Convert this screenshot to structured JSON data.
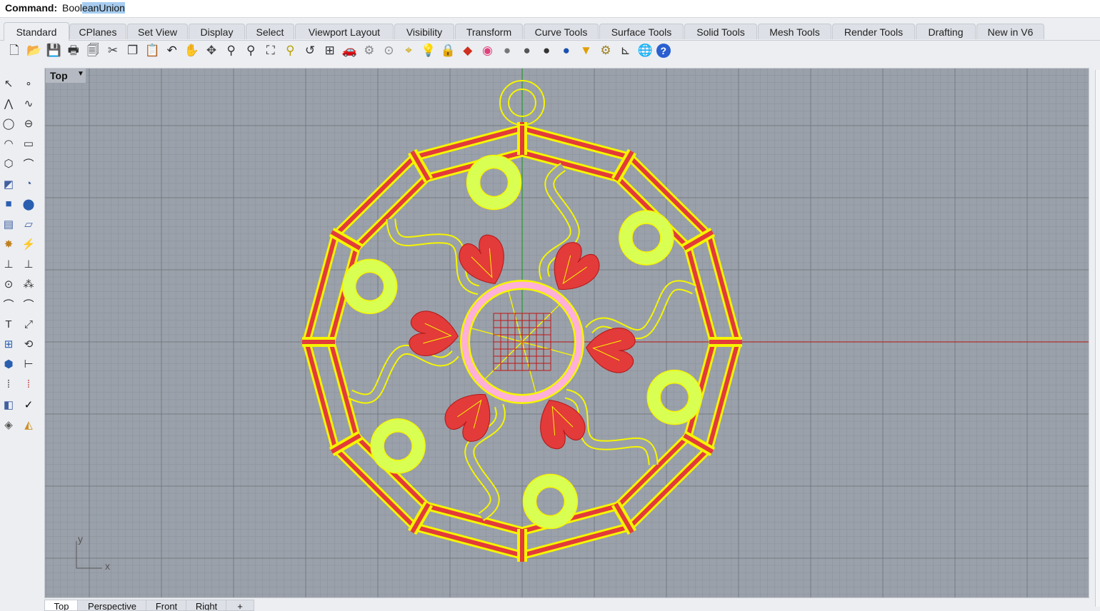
{
  "command": {
    "label": "Command:",
    "typed": "Bool",
    "selected": "eanUnion"
  },
  "tabs": [
    {
      "label": "Standard",
      "active": true
    },
    {
      "label": "CPlanes"
    },
    {
      "label": "Set View"
    },
    {
      "label": "Display"
    },
    {
      "label": "Select"
    },
    {
      "label": "Viewport Layout"
    },
    {
      "label": "Visibility"
    },
    {
      "label": "Transform"
    },
    {
      "label": "Curve Tools"
    },
    {
      "label": "Surface Tools"
    },
    {
      "label": "Solid Tools"
    },
    {
      "label": "Mesh Tools"
    },
    {
      "label": "Render Tools"
    },
    {
      "label": "Drafting"
    },
    {
      "label": "New in V6"
    }
  ],
  "toolbar_icons": [
    "new-file-icon",
    "open-folder-icon",
    "save-icon",
    "print-icon",
    "import-icon",
    "cut-icon",
    "copy-icon",
    "paste-icon",
    "undo-icon",
    "pan-hand-icon",
    "rotate-view-icon",
    "zoom-icon",
    "zoom-window-icon",
    "zoom-extents-icon",
    "zoom-selected-icon",
    "undo-view-icon",
    "four-viewports-icon",
    "car-icon",
    "named-views-icon",
    "cplane-icon",
    "snap-icon",
    "light-bulb-icon",
    "lock-icon",
    "layer-icon",
    "color-wheel-icon",
    "shaded-sphere-icon",
    "rendered-sphere-icon",
    "material-sphere-icon",
    "blue-sphere-icon",
    "filter-icon",
    "gear-options-icon",
    "dimension-icon",
    "globe-icon",
    "help-icon"
  ],
  "left_icons": [
    "select-arrow-icon",
    "point-icon",
    "polyline-icon",
    "curve-icon",
    "circle-icon",
    "ellipse-icon",
    "arc-icon",
    "rectangle-icon",
    "polygon-icon",
    "fillet-icon",
    "surface-icon",
    "revolve-icon",
    "box-icon",
    "boolean-icon",
    "cylinder-icon",
    "plane-icon",
    "explode-icon",
    "trim-icon",
    "join-icon",
    "extend-icon",
    "group-icon",
    "points-icon",
    "offset-icon",
    "blend-icon",
    "text-icon",
    "scale-icon",
    "move-icon",
    "rotate-icon",
    "box-edit-icon",
    "dimension-icon",
    "array-icon",
    "align-icon",
    "taper-icon",
    "check-icon",
    "mesh-icon",
    "render-icon"
  ],
  "viewport": {
    "name": "Top",
    "menu_glyph": "▼",
    "axis_x": "x",
    "axis_y": "y"
  },
  "viewport_tabs": [
    "Top",
    "Perspective",
    "Front",
    "Right",
    "+"
  ],
  "colors": {
    "viewport_bg": "#9aa1aa",
    "x_axis": "#b03030",
    "y_axis": "#2e9a3a",
    "curve_yellow": "#f5f500",
    "red_fill": "#e33a3a",
    "donut_fill": "#d9ff52",
    "pink": "#ffb0d8"
  }
}
